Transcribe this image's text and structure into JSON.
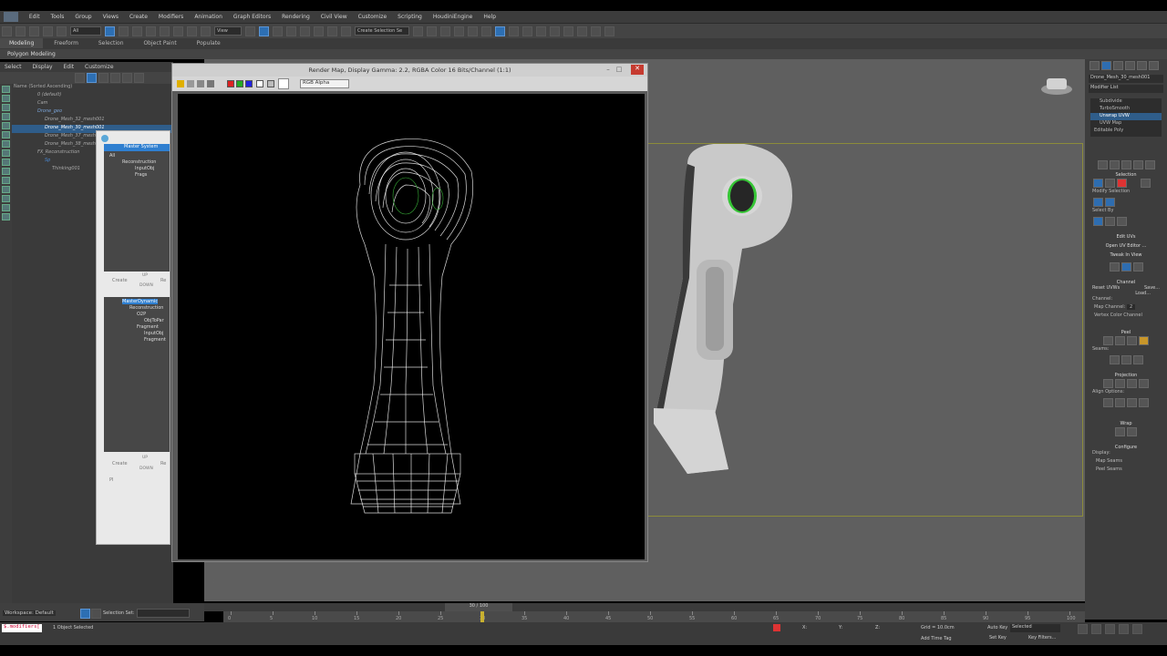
{
  "menubar": {
    "items": [
      "Edit",
      "Tools",
      "Group",
      "Views",
      "Create",
      "Modifiers",
      "Animation",
      "Graph Editors",
      "Rendering",
      "Civil View",
      "Customize",
      "Scripting",
      "HoudiniEngine",
      "Help"
    ]
  },
  "toolbar": {
    "filter_value": "All",
    "view_value": "View",
    "selection_set_placeholder": "Create Selection Se"
  },
  "ribbon": {
    "tabs": [
      "Modeling",
      "Freeform",
      "Selection",
      "Object Paint",
      "Populate"
    ],
    "subtitle": "Polygon Modeling"
  },
  "scene_explorer": {
    "menu": [
      "Select",
      "Display",
      "Edit",
      "Customize"
    ],
    "header": "Name (Sorted Ascending)",
    "items": [
      "0 (default)",
      "Cam",
      "Drone_geo",
      "Drone_Mesh_32_mesh001",
      "Drone_Mesh_30_mesh001",
      "Drone_Mesh_37_mesh001",
      "Drone_Mesh_38_mesh001",
      "FX_Reconstruction",
      "Sp",
      "Thinking001"
    ]
  },
  "schematic": {
    "title_tag": "Master System",
    "tree1": [
      "All",
      "Reconstruction",
      "InputObj",
      "Frags"
    ],
    "create_label": "Create",
    "up_label": "UP",
    "down_label": "DOWN",
    "re_label": "Re",
    "tree2_title": "MasterDynamic",
    "tree2": [
      "Reconstruction",
      "O2P",
      "ObjToPar",
      "Fragment",
      "InputObj",
      "Fragment"
    ],
    "pi_label": "PI"
  },
  "render_window": {
    "title": "Render Map, Display Gamma: 2.2, RGBA Color 16 Bits/Channel (1:1)",
    "channel": "RGB Alpha",
    "close_glyph": "✕",
    "min_glyph": "–",
    "max_glyph": "□"
  },
  "command_panel": {
    "object_name": "Drone_Mesh_30_mesh001",
    "modifier_list_label": "Modifier List",
    "modifiers": [
      "Subdivide",
      "TurboSmooth",
      "Unwrap UVW",
      "UVW Map",
      "Editable Poly"
    ],
    "selected_modifier_index": 2,
    "sections": {
      "selection": "Selection",
      "modify_selection": "Modify Selection",
      "select_by": "Select By",
      "edit_uvs": "Edit UVs",
      "open_uv_editor": "Open UV Editor ...",
      "tweak_in_view": "Tweak In View",
      "channel": "Channel",
      "reset_uvws": "Reset UVWs",
      "save": "Save...",
      "load": "Load...",
      "channel_label": "Channel:",
      "map_channel": "Map Channel:",
      "map_channel_value": "2",
      "vertex_color_channel": "Vertex Color Channel",
      "peel": "Peel",
      "seams": "Seams:",
      "projection": "Projection",
      "align_options": "Align Options:",
      "wrap": "Wrap",
      "configure": "Configure",
      "display": "Display:",
      "map_seams": "Map Seams",
      "peel_seams": "Peel Seams"
    }
  },
  "timeline": {
    "frame_display": "30 / 100",
    "ticks": [
      0,
      5,
      10,
      15,
      20,
      25,
      30,
      35,
      40,
      45,
      50,
      55,
      60,
      65,
      70,
      75,
      80,
      85,
      90,
      95,
      100
    ],
    "current_frame": 30
  },
  "status": {
    "workspace": "Workspace: Default",
    "selection_set_label": "Selection Set:",
    "objects_selected": "1 Object Selected",
    "maxscript": "$.modifiers[",
    "grid": "Grid = 10.0cm",
    "add_time_tag": "Add Time Tag",
    "auto_key": "Auto Key",
    "set_key": "Set Key",
    "selected": "Selected",
    "key_filters": "Key Filters...",
    "x_label": "X:",
    "y_label": "Y:",
    "z_label": "Z:"
  },
  "colors": {
    "accent": "#2f5d8a",
    "close_button": "#c63b30",
    "viewport_bg": "#5f5f5f",
    "viewport_frame": "#8c8c3a"
  }
}
